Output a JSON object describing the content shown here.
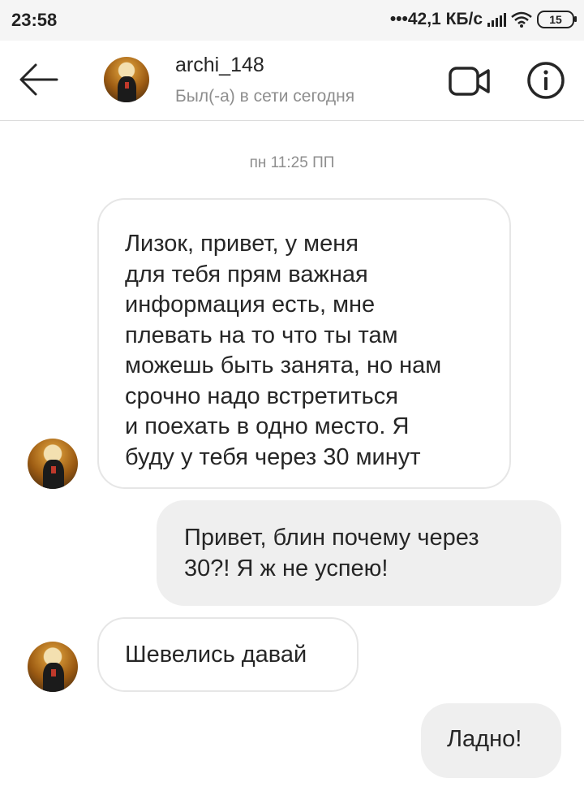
{
  "status_bar": {
    "time": "23:58",
    "network": "•••42,1 КБ/с",
    "battery": "15"
  },
  "header": {
    "username": "archi_148",
    "status": "Был(-а) в сети сегодня",
    "icons": [
      "back-arrow-icon",
      "video-call-icon",
      "info-icon"
    ]
  },
  "chat": {
    "timestamp": "пн 11:25 ПП",
    "messages": [
      {
        "from": "them",
        "text": "Лизок, привет, у меня\nдля тебя прям важная\nинформация есть, мне\nплевать на то что ты там\nможешь быть занята, но нам\nсрочно надо встретиться\nи поехать в одно место. Я\nбуду у тебя через 30 минут"
      },
      {
        "from": "me",
        "text": "Привет, блин почему через\n30?! Я ж не успею!"
      },
      {
        "from": "them",
        "text": "Шевелись давай"
      },
      {
        "from": "me",
        "text": "Ладно!"
      }
    ]
  },
  "colors": {
    "incoming_border": "#e6e6e6",
    "outgoing_bg": "#efefef",
    "secondary_text": "#8e8e8e"
  }
}
